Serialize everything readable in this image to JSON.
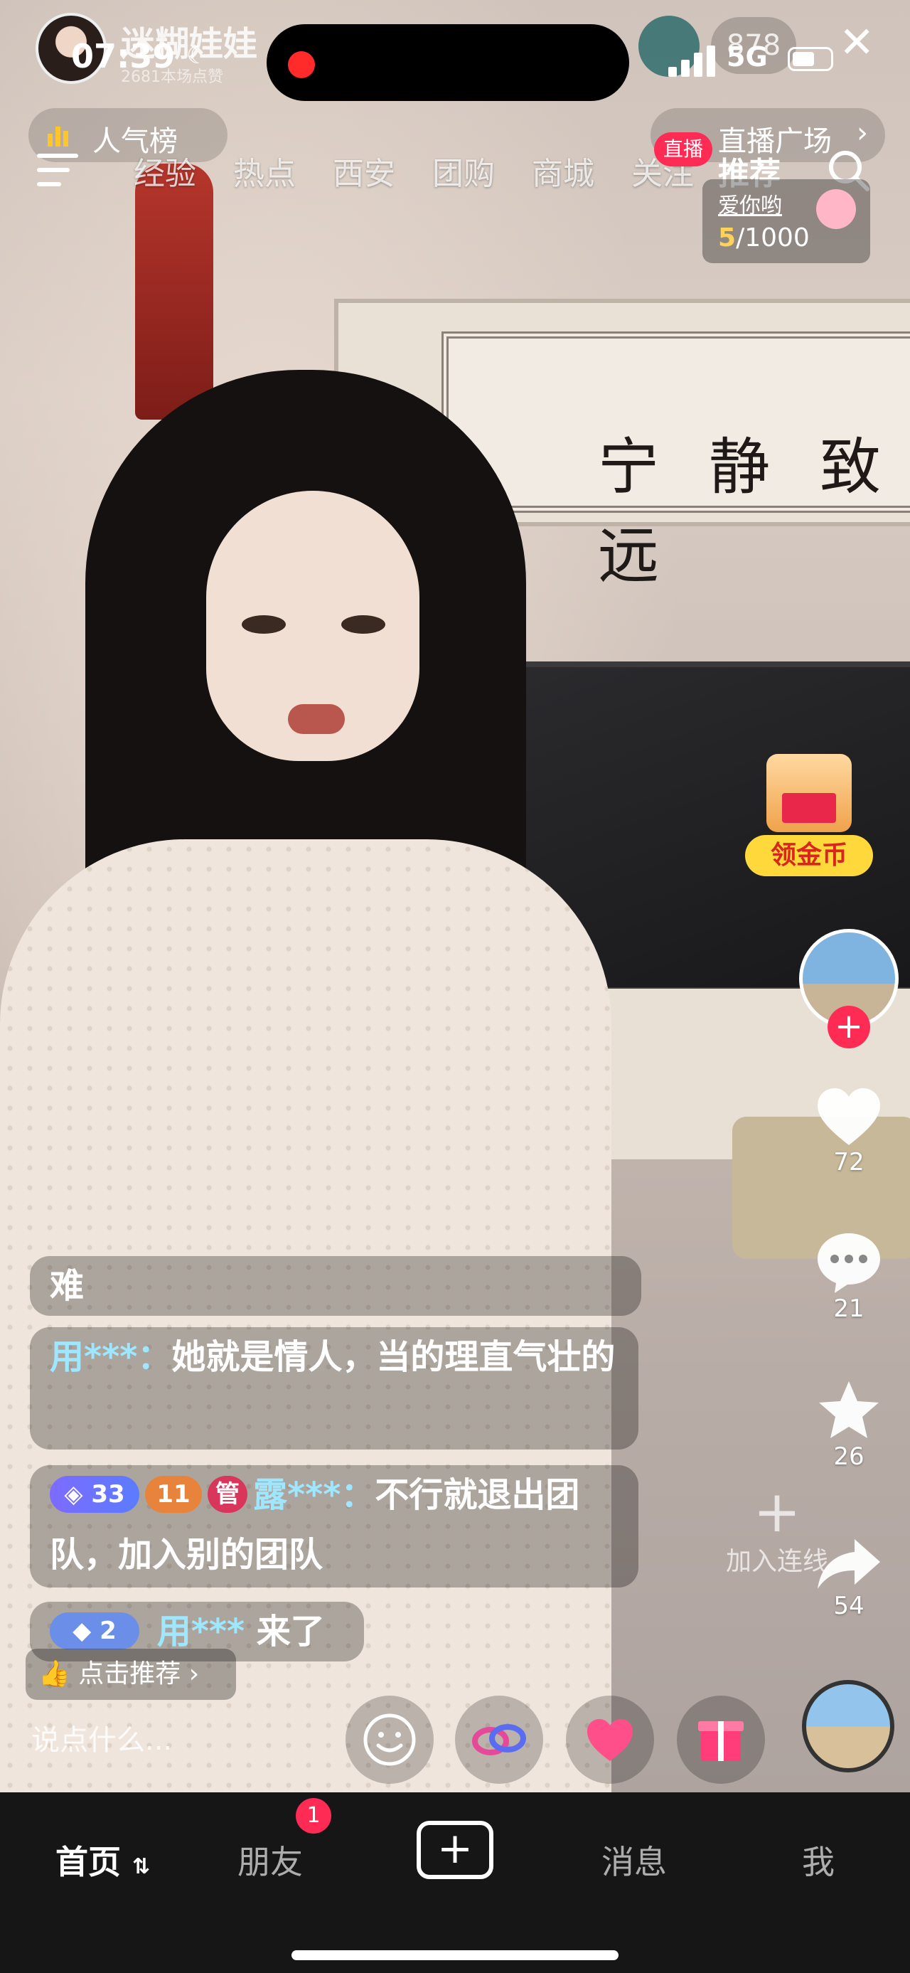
{
  "status_bar": {
    "time": "07:39",
    "network": "5G"
  },
  "streamer": {
    "name": "迷糊娃娃",
    "likes": "2681本场点赞"
  },
  "viewer_count": "878",
  "rank_pill": {
    "label": "人气榜"
  },
  "plaza_pill": {
    "label": "直播广场",
    "chevron": "›"
  },
  "nav": {
    "tabs": [
      "经验",
      "热点",
      "西安",
      "团购",
      "商城",
      "关注"
    ],
    "live_badge": "直播",
    "active_tab": "推荐"
  },
  "task_card": {
    "title": "爱你哟",
    "current": "5",
    "total": "/1000"
  },
  "coin_box": {
    "label": "领金币"
  },
  "rail": {
    "likes": "72",
    "comments": "21",
    "favorites": "26",
    "shares": "54"
  },
  "scroll_text": "宁静致远",
  "comments": [
    {
      "text": "难"
    },
    {
      "user": "用***：",
      "text": "她就是情人，当的理直气壮的"
    },
    {
      "level": "33",
      "fan_level": "11",
      "admin": "管",
      "user": "露***：",
      "text": "不行就退出团队，加入别的团队"
    },
    {
      "level": "2",
      "user": "用***",
      "text": "来了"
    }
  ],
  "join_line": {
    "label": "加入连线"
  },
  "like_recommend": {
    "label": "点击推荐",
    "chevron": "›"
  },
  "say_input": {
    "placeholder": "说点什么..."
  },
  "tab_bar": {
    "home": "首页",
    "friends": "朋友",
    "friends_badge": "1",
    "create": "+",
    "messages": "消息",
    "me": "我"
  },
  "colors": {
    "accent": "#fe2c55",
    "username": "#9fe6ff",
    "coin": "#ffd83b"
  }
}
